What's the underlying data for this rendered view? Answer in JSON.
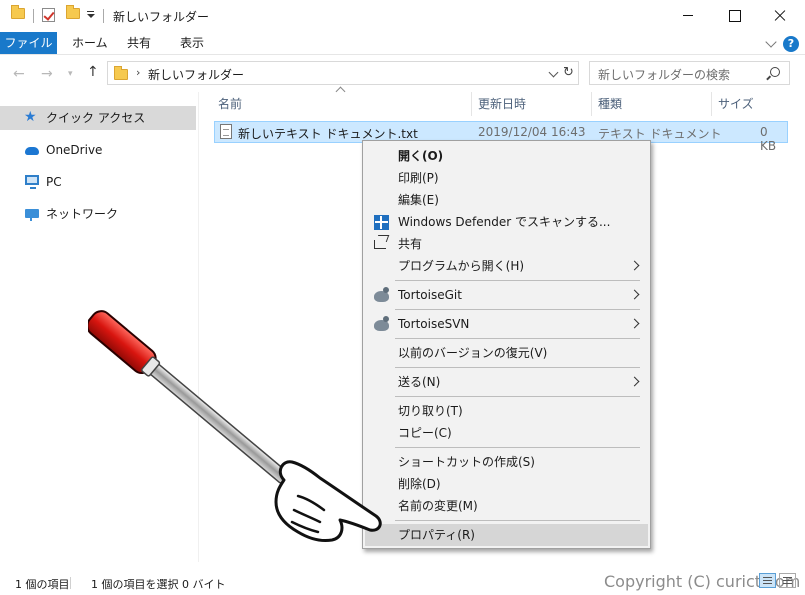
{
  "window": {
    "title": "新しいフォルダー",
    "controls": [
      "minimize",
      "maximize",
      "close"
    ]
  },
  "ribbon": {
    "tabs": [
      "ファイル",
      "ホーム",
      "共有",
      "表示"
    ]
  },
  "address": {
    "path": "新しいフォルダー",
    "search_placeholder": "新しいフォルダーの検索"
  },
  "nav": {
    "items": [
      {
        "label": "クイック アクセス",
        "icon": "star-icon",
        "selected": true
      },
      {
        "label": "OneDrive",
        "icon": "cloud-icon",
        "selected": false
      },
      {
        "label": "PC",
        "icon": "pc-icon",
        "selected": false
      },
      {
        "label": "ネットワーク",
        "icon": "network-icon",
        "selected": false
      }
    ]
  },
  "columns": [
    "名前",
    "更新日時",
    "種類",
    "サイズ"
  ],
  "file": {
    "name": "新しいテキスト ドキュメント.txt",
    "modified": "2019/12/04 16:43",
    "type": "テキスト ドキュメント",
    "size": "0 KB"
  },
  "context_menu": {
    "open": "開く(O)",
    "print": "印刷(P)",
    "edit": "編集(E)",
    "defender": "Windows Defender でスキャンする...",
    "share": "共有",
    "open_with": "プログラムから開く(H)",
    "tortoisegit": "TortoiseGit",
    "tortoisesvn": "TortoiseSVN",
    "restore": "以前のバージョンの復元(V)",
    "send_to": "送る(N)",
    "cut": "切り取り(T)",
    "copy": "コピー(C)",
    "shortcut": "ショートカットの作成(S)",
    "delete": "削除(D)",
    "rename": "名前の変更(M)",
    "properties": "プロパティ(R)",
    "highlighted": "properties"
  },
  "status": {
    "count": "1 個の項目",
    "selected": "1 個の項目を選択  0 バイト",
    "copyright": "Copyright (C) curict.com"
  },
  "colors": {
    "accent": "#1979ca",
    "selection": "#cce8ff",
    "pointer_handle": "#e0201b"
  }
}
